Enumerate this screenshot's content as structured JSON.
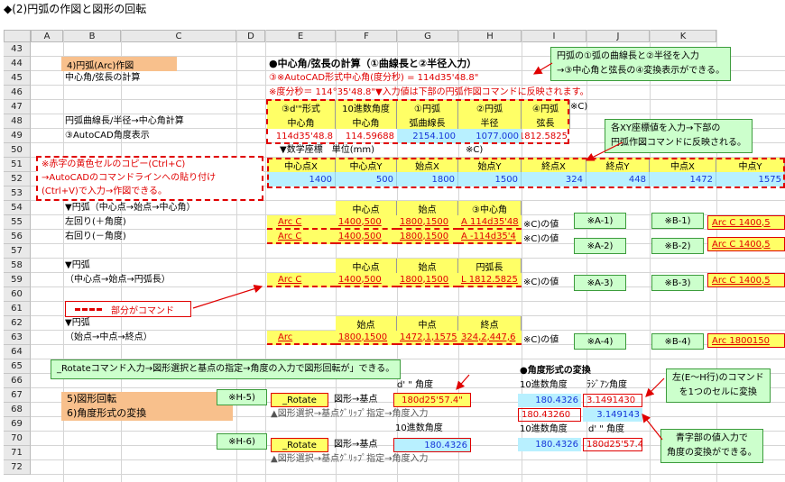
{
  "title": "◆(2)円弧の作図と図形の回転",
  "columns": [
    "A",
    "B",
    "C",
    "D",
    "E",
    "F",
    "G",
    "H",
    "I",
    "J",
    "K"
  ],
  "rows": [
    "43",
    "44",
    "45",
    "46",
    "47",
    "48",
    "49",
    "50",
    "51",
    "52",
    "53",
    "54",
    "55",
    "56",
    "57",
    "58",
    "59",
    "60",
    "61",
    "62",
    "63",
    "64",
    "65",
    "66",
    "67",
    "68",
    "69",
    "70",
    "71",
    "72"
  ],
  "sec4": {
    "label": "4)円弧(Arc)作図",
    "sub": "中心角/弦長の計算",
    "r48": "円弧曲線長/半径→中心角計算",
    "r49": "③AutoCAD角度表示",
    "heading": "●中心角/弦長の計算（①曲線長と②半径入力）",
    "note1": "③※AutoCAD形式中心角(度分秒) = 114d35'48.8\"",
    "note2": "※度分秒＝ 114°35'48.8\"▼入力値は下部の円弧作図コマンドに反映されます。",
    "h47": [
      "③d'\"形式",
      "10進数角度",
      "①円弧",
      "②円弧",
      "④円弧"
    ],
    "h48": [
      "中心角",
      "中心角",
      "弧曲線長",
      "半径",
      "弦長"
    ],
    "v49": [
      "114d35'48.8",
      "114.59688",
      "2154.100",
      "1077.000",
      "1812.5825"
    ],
    "noteC": "※C)"
  },
  "coords": {
    "title": "▼数学座標　単位(mm)",
    "noteC": "※C)",
    "headers": [
      "中心点X",
      "中心点Y",
      "始点X",
      "始点Y",
      "終点X",
      "終点Y",
      "中点X",
      "中点Y"
    ],
    "values": [
      "1400",
      "500",
      "1800",
      "1500",
      "324",
      "448",
      "1472",
      "1575"
    ]
  },
  "leftnote": [
    "※赤字の黄色セルのコピー(Ctrl+C)",
    "→AutoCADのコマンドラインへの貼り付け",
    "(Ctrl+V)で入力→作図できる。"
  ],
  "arc1": {
    "title": "▼円弧（中心点→始点→中心角）",
    "left": "左回り(＋角度)",
    "right": "右回り(－角度)",
    "hdrs": [
      "中心点",
      "始点",
      "③中心角"
    ],
    "r55": [
      "Arc C",
      "1400,500",
      "1800,1500",
      "A 114d35'48"
    ],
    "r56": [
      "Arc C",
      "1400,500",
      "1800,1500",
      "A -114d35'4"
    ],
    "cval": "※C)の値"
  },
  "arc2": {
    "title": "▼円弧",
    "sub": "（中心点→始点→円弧長）",
    "hdrs": [
      "中心点",
      "始点",
      "円弧長"
    ],
    "r59": [
      "Arc C",
      "1400,500",
      "1800,1500",
      "L 1812.5825"
    ],
    "cval": "※C)の値"
  },
  "legend": "部分がコマンド",
  "arc3": {
    "title": "▼円弧",
    "sub": "（始点→中点→終点）",
    "hdrs": [
      "始点",
      "中点",
      "終点"
    ],
    "r63": [
      "Arc",
      "1800,1500",
      "1472,1,1575",
      "324,2,447,6"
    ],
    "cval": "※C)の値"
  },
  "tags": {
    "a1": "※A-1)",
    "a2": "※A-2)",
    "a3": "※A-3)",
    "a4": "※A-4)",
    "b1": "※B-1)",
    "b2": "※B-2)",
    "b3": "※B-3)",
    "b4": "※B-4)",
    "h5": "※H-5)",
    "h6": "※H-6)"
  },
  "cmdk": {
    "k55": "Arc C 1400,5",
    "k56": "Arc C 1400,5",
    "k59": "Arc C 1400,5",
    "k63": "Arc 1800150"
  },
  "callouts": {
    "top": [
      "円弧の①弧の曲線長と②半径を入力",
      "→③中心角と弦長の④変換表示ができる。"
    ],
    "xy": [
      "各XY座標値を入力→下部の",
      "円弧作図コマンドに反映される。"
    ],
    "rotate": "_Rotateコマンド入力→図形選択と基点の指定→角度の入力で図形回転が」できる。",
    "conv": [
      "左(E～H行)のコマンド",
      "を1つのセルに変換"
    ],
    "blue": [
      "青字部の値入力で",
      "角度の変換ができる。"
    ]
  },
  "sec5": {
    "l5": "5)図形回転",
    "l6": "6)角度形式の変換",
    "rotate": "_Rotate",
    "arrow": "図形→基点",
    "dd": "d' \" 角度",
    "v67": "180d25'57.4\"",
    "hint": "▲図形選択→基点ｸﾞﾘｯﾌﾟ指定→角度入力",
    "dec": "10進数角度",
    "v70": "180.4326"
  },
  "conv": {
    "title": "●角度形式の変換",
    "h66a": "10進数角度",
    "h66b": "ﾗｼﾞｱﾝ角度",
    "v67a": "180.4326",
    "v67b": "3.1491430",
    "v68a": "180.43260",
    "v68b": "3.149143",
    "h69a": "10進数角度",
    "h69b": "d' \" 角度",
    "v70a": "180.4326",
    "v70b": "180d25'57.4\""
  }
}
